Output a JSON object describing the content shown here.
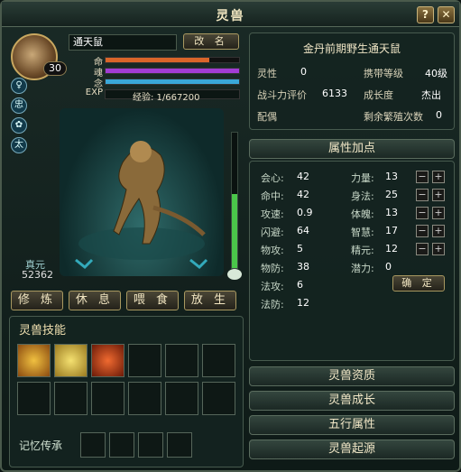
{
  "window": {
    "title": "灵兽",
    "help_label": "?",
    "close_label": "✕"
  },
  "pet": {
    "name": "通天鼠",
    "rename_label": "改 名",
    "level": "30",
    "bars": [
      {
        "label": "命",
        "color": "#d9652a",
        "fill": 0.78
      },
      {
        "label": "魂",
        "color": "#a23cd4",
        "fill": 1.0
      },
      {
        "label": "念",
        "color": "#3aa7d8",
        "fill": 1.0
      }
    ],
    "exp_label": "EXP",
    "exp_text": "经验: 1/667200",
    "side_icons": [
      "♀",
      "忠",
      "✿",
      "太"
    ],
    "zhenyuan_label": "真元",
    "zhenyuan_value": "52362",
    "gauge_fill": 0.55
  },
  "actions": [
    {
      "label": "修 炼"
    },
    {
      "label": "休 息"
    },
    {
      "label": "喂 食"
    },
    {
      "label": "放 生"
    }
  ],
  "info": {
    "title": "金丹前期野生通天鼠",
    "rows": [
      {
        "l1": "灵性",
        "v1": "0",
        "l2": "携带等级",
        "v2": "40级"
      },
      {
        "l1": "战斗力评价",
        "v1": "6133",
        "l2": "成长度",
        "v2": "杰出"
      },
      {
        "l1": "配偶",
        "v1": "",
        "l2": "剩余繁殖次数",
        "v2": "0"
      }
    ]
  },
  "attributes": {
    "header": "属性加点",
    "left": [
      {
        "label": "会心:",
        "value": "42"
      },
      {
        "label": "命中:",
        "value": "42"
      },
      {
        "label": "攻速:",
        "value": "0.9"
      },
      {
        "label": "闪避:",
        "value": "64"
      },
      {
        "label": "物攻:",
        "value": "5"
      },
      {
        "label": "物防:",
        "value": "38"
      },
      {
        "label": "法攻:",
        "value": "6"
      },
      {
        "label": "法防:",
        "value": "12"
      }
    ],
    "right": [
      {
        "label": "力量:",
        "value": "13"
      },
      {
        "label": "身法:",
        "value": "25"
      },
      {
        "label": "体魄:",
        "value": "13"
      },
      {
        "label": "智慧:",
        "value": "17"
      },
      {
        "label": "精元:",
        "value": "12"
      },
      {
        "label": "潜力:",
        "value": "0"
      }
    ],
    "confirm_label": "确 定",
    "minus": "−",
    "plus": "+"
  },
  "skills": {
    "header": "灵兽技能",
    "memory_label": "记忆传承"
  },
  "sections": [
    {
      "label": "灵兽资质"
    },
    {
      "label": "灵兽成长"
    },
    {
      "label": "五行属性"
    },
    {
      "label": "灵兽起源"
    }
  ]
}
